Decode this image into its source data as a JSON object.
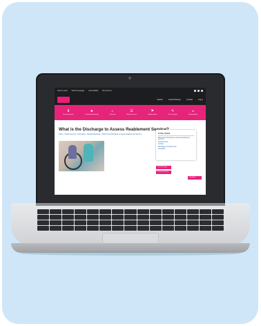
{
  "site": {
    "topbar": [
      "About Leeds",
      "Select language",
      "Accessibility",
      "My Account"
    ],
    "brand": {
      "links": [
        "Search",
        "Leeds Directory",
        "Contact",
        "Log in"
      ]
    },
    "nav": [
      {
        "icon": "⬇",
        "label": "Direct payments"
      },
      {
        "icon": "♣",
        "label": "Living independently"
      },
      {
        "icon": "⌂",
        "label": "Housing"
      },
      {
        "icon": "☰",
        "label": "Health services"
      },
      {
        "icon": "⚑",
        "label": "Getting about"
      },
      {
        "icon": "✎",
        "label": "Carer support"
      },
      {
        "icon": "☺",
        "label": "Safeguarding"
      }
    ],
    "page_title": "What is the Discharge to Assess Reablement Service?",
    "breadcrumb": "Home › Social Services › Information › Hospital discharge › What is the Discharge to Assess Reablement Service?",
    "toc": {
      "heading": "In this article",
      "items": [
        "What is the Discharge to Assess Reablement Service?",
        "Requirements",
        "Contact",
        "Discharge for Assess plan",
        "Feedback"
      ]
    },
    "buttons": {
      "print": "Print this page",
      "share": "Share this article",
      "feedback": "Feedback"
    }
  },
  "colors": {
    "accent": "#e6247a",
    "background": "#cfe6f8"
  }
}
